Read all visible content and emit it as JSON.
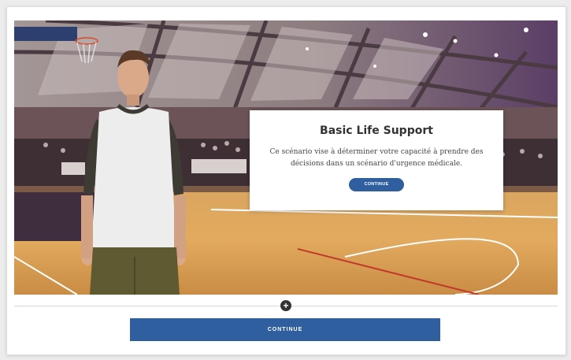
{
  "scenario": {
    "title": "Basic Life Support",
    "description": "Ce scénario vise à déterminer votre capacité à prendre des décisions dans un scénario d'urgence médicale.",
    "continue_label": "CONTINUE"
  },
  "footer": {
    "add_icon": "+",
    "continue_label": "CONTINUE"
  },
  "colors": {
    "accent": "#2f5f9e",
    "plus_button": "#333333"
  }
}
